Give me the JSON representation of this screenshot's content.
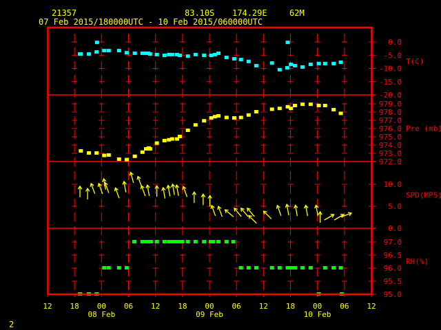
{
  "header": {
    "station_id": "21357",
    "latitude": "83.10S",
    "longitude": "174.29E",
    "elevation": "62M",
    "time_range": "07 Feb 2015/180000UTC - 10 Feb 2015/060000UTC"
  },
  "footer": {
    "page_number": "2"
  },
  "colors": {
    "frame": "#ff0000",
    "temperature": "#00ffff",
    "pressure": "#ffff00",
    "wind": "#ffff00",
    "rh": "#00ff00",
    "text": "#ffff00"
  },
  "chart_data": {
    "type": "scatter",
    "x_units": "hours since 07 Feb 12UTC",
    "xlim": [
      0,
      72
    ],
    "x_tick_hours": [
      0,
      6,
      12,
      18,
      24,
      30,
      36,
      42,
      48,
      54,
      60,
      66,
      72
    ],
    "x_tick_labels": [
      "12",
      "18",
      "00",
      "06",
      "12",
      "18",
      "00",
      "06",
      "12",
      "18",
      "00",
      "06",
      "12"
    ],
    "date_labels": [
      {
        "label": "08 Feb",
        "hour": 12
      },
      {
        "label": "09 Feb",
        "hour": 36
      },
      {
        "label": "10 Feb",
        "hour": 60
      }
    ],
    "panels": [
      {
        "name": "temperature",
        "label": "T(C)",
        "ylim": [
          -20,
          0
        ],
        "ticks": [
          0,
          -5,
          -10,
          -15,
          -20
        ],
        "tick_labels": [
          "0.0",
          "-5.0",
          "-10.0",
          "-15.0",
          "-20.0"
        ],
        "points": [
          [
            7.2,
            -4.7
          ],
          [
            7.4,
            -4.7
          ],
          [
            9.2,
            -4.7
          ],
          [
            10.9,
            -3.9
          ],
          [
            11.0,
            -0.3
          ],
          [
            12.6,
            -3.4
          ],
          [
            13.6,
            -3.4
          ],
          [
            15.9,
            -3.4
          ],
          [
            17.6,
            -4.2
          ],
          [
            19.4,
            -4.4
          ],
          [
            21.1,
            -4.4
          ],
          [
            21.9,
            -4.4
          ],
          [
            22.4,
            -4.4
          ],
          [
            22.8,
            -4.7
          ],
          [
            24.3,
            -4.9
          ],
          [
            26.0,
            -5.2
          ],
          [
            27.0,
            -4.9
          ],
          [
            27.7,
            -4.9
          ],
          [
            28.8,
            -4.9
          ],
          [
            29.4,
            -5.2
          ],
          [
            31.2,
            -5.5
          ],
          [
            32.9,
            -4.9
          ],
          [
            34.8,
            -5.2
          ],
          [
            36.4,
            -5.2
          ],
          [
            37.2,
            -4.9
          ],
          [
            38.0,
            -4.4
          ],
          [
            39.8,
            -6.0
          ],
          [
            41.5,
            -6.5
          ],
          [
            43.0,
            -6.8
          ],
          [
            44.7,
            -7.5
          ],
          [
            46.4,
            -9.1
          ],
          [
            49.9,
            -8.1
          ],
          [
            51.6,
            -10.6
          ],
          [
            53.3,
            -9.9
          ],
          [
            53.4,
            -0.3
          ],
          [
            54.1,
            -8.6
          ],
          [
            55.0,
            -9.1
          ],
          [
            56.7,
            -9.6
          ],
          [
            58.5,
            -8.6
          ],
          [
            60.3,
            -8.3
          ],
          [
            61.7,
            -8.3
          ],
          [
            63.6,
            -8.3
          ],
          [
            65.2,
            -7.8
          ]
        ]
      },
      {
        "name": "pressure",
        "label": "Pre (mb)",
        "ylim": [
          972,
          979
        ],
        "ticks": [
          979,
          978,
          977,
          976,
          975,
          974,
          973,
          972
        ],
        "tick_labels": [
          "979.0",
          "978.0",
          "977.0",
          "976.0",
          "975.0",
          "974.0",
          "973.0",
          "972.0"
        ],
        "points": [
          [
            7.4,
            973.25
          ],
          [
            9.2,
            973.0
          ],
          [
            10.9,
            973.0
          ],
          [
            12.6,
            972.7
          ],
          [
            13.6,
            972.75
          ],
          [
            15.9,
            972.25
          ],
          [
            17.6,
            972.2
          ],
          [
            19.4,
            972.6
          ],
          [
            21.1,
            973.1
          ],
          [
            21.9,
            973.5
          ],
          [
            22.5,
            973.6
          ],
          [
            22.8,
            973.5
          ],
          [
            24.3,
            974.2
          ],
          [
            26.0,
            974.5
          ],
          [
            27.0,
            974.6
          ],
          [
            27.7,
            974.7
          ],
          [
            28.8,
            974.7
          ],
          [
            29.4,
            975.0
          ],
          [
            31.2,
            975.75
          ],
          [
            32.9,
            976.4
          ],
          [
            34.8,
            976.9
          ],
          [
            36.4,
            977.25
          ],
          [
            37.2,
            977.4
          ],
          [
            38.0,
            977.5
          ],
          [
            39.8,
            977.3
          ],
          [
            41.5,
            977.25
          ],
          [
            43.0,
            977.3
          ],
          [
            44.7,
            977.6
          ],
          [
            46.4,
            978.0
          ],
          [
            49.9,
            978.3
          ],
          [
            51.6,
            978.4
          ],
          [
            53.4,
            978.6
          ],
          [
            54.1,
            978.4
          ],
          [
            55.0,
            978.75
          ],
          [
            56.7,
            978.9
          ],
          [
            58.5,
            978.9
          ],
          [
            60.3,
            978.75
          ],
          [
            61.7,
            978.75
          ],
          [
            63.6,
            978.25
          ],
          [
            65.2,
            977.8
          ]
        ]
      },
      {
        "name": "wind",
        "label": "SPD(MPS)",
        "ylim": [
          0,
          12.5
        ],
        "ticks": [
          10,
          5,
          0
        ],
        "tick_labels": [
          "10.0",
          "5.0",
          "0.0"
        ],
        "points_hour_speed_direction": [
          [
            7.2,
            8.3,
            0
          ],
          [
            8.9,
            7.8,
            0
          ],
          [
            10.1,
            9.0,
            -20
          ],
          [
            11.8,
            9.0,
            -20
          ],
          [
            12.7,
            10.0,
            -10
          ],
          [
            13.2,
            9.2,
            -20
          ],
          [
            15.5,
            8.0,
            -20
          ],
          [
            17.2,
            9.4,
            -10
          ],
          [
            18.8,
            11.5,
            -15
          ],
          [
            20.5,
            10.6,
            -20
          ],
          [
            21.3,
            8.5,
            -20
          ],
          [
            22.4,
            8.6,
            -10
          ],
          [
            24.3,
            8.4,
            0
          ],
          [
            25.9,
            8.0,
            -10
          ],
          [
            27.0,
            8.5,
            -10
          ],
          [
            28.0,
            8.8,
            -10
          ],
          [
            28.9,
            8.6,
            -10
          ],
          [
            30.6,
            8.3,
            -20
          ],
          [
            32.6,
            7.0,
            0
          ],
          [
            34.6,
            6.5,
            0
          ],
          [
            36.1,
            6.2,
            0
          ],
          [
            36.9,
            4.0,
            -20
          ],
          [
            38.4,
            3.8,
            -20
          ],
          [
            40.4,
            3.4,
            -50
          ],
          [
            42.3,
            3.6,
            -40
          ],
          [
            43.8,
            3.6,
            -40
          ],
          [
            45.2,
            3.6,
            -40
          ],
          [
            45.6,
            2.0,
            -45
          ],
          [
            48.9,
            3.0,
            -45
          ],
          [
            51.5,
            4.0,
            -20
          ],
          [
            53.4,
            4.2,
            -10
          ],
          [
            55.3,
            4.0,
            -10
          ],
          [
            57.6,
            4.0,
            -10
          ],
          [
            59.9,
            4.0,
            -10
          ],
          [
            60.6,
            2.5,
            0
          ],
          [
            62.6,
            2.5,
            60
          ],
          [
            64.8,
            2.5,
            60
          ],
          [
            66.4,
            3.0,
            70
          ]
        ]
      },
      {
        "name": "rh",
        "label": "RH(%)",
        "ylim": [
          95,
          97.3
        ],
        "ticks": [
          97,
          96.5,
          96,
          95.5,
          95
        ],
        "tick_labels": [
          "97.0",
          "96.5",
          "96.0",
          "95.5",
          "95.0"
        ],
        "points": [
          [
            7.2,
            95
          ],
          [
            9.2,
            95
          ],
          [
            10.9,
            95
          ],
          [
            12.6,
            96
          ],
          [
            13.6,
            96
          ],
          [
            15.9,
            96
          ],
          [
            17.6,
            96
          ],
          [
            19.3,
            97
          ],
          [
            21.1,
            97
          ],
          [
            21.7,
            97
          ],
          [
            22.4,
            97
          ],
          [
            23.0,
            97
          ],
          [
            24.3,
            97
          ],
          [
            26.0,
            97
          ],
          [
            27.0,
            97
          ],
          [
            27.6,
            97
          ],
          [
            28.2,
            97
          ],
          [
            29.1,
            97
          ],
          [
            29.9,
            97
          ],
          [
            31.2,
            97
          ],
          [
            32.9,
            97
          ],
          [
            34.8,
            97
          ],
          [
            36.3,
            97
          ],
          [
            36.8,
            97
          ],
          [
            38.0,
            97
          ],
          [
            39.8,
            97
          ],
          [
            41.3,
            97
          ],
          [
            43.0,
            96
          ],
          [
            44.7,
            96
          ],
          [
            46.4,
            96
          ],
          [
            49.9,
            96
          ],
          [
            51.6,
            96
          ],
          [
            53.4,
            96
          ],
          [
            54.1,
            96
          ],
          [
            55.0,
            96
          ],
          [
            56.7,
            96
          ],
          [
            58.5,
            96
          ],
          [
            60.3,
            95
          ],
          [
            61.7,
            96
          ],
          [
            63.6,
            96
          ],
          [
            65.2,
            96
          ],
          [
            65.4,
            95
          ]
        ]
      }
    ]
  }
}
